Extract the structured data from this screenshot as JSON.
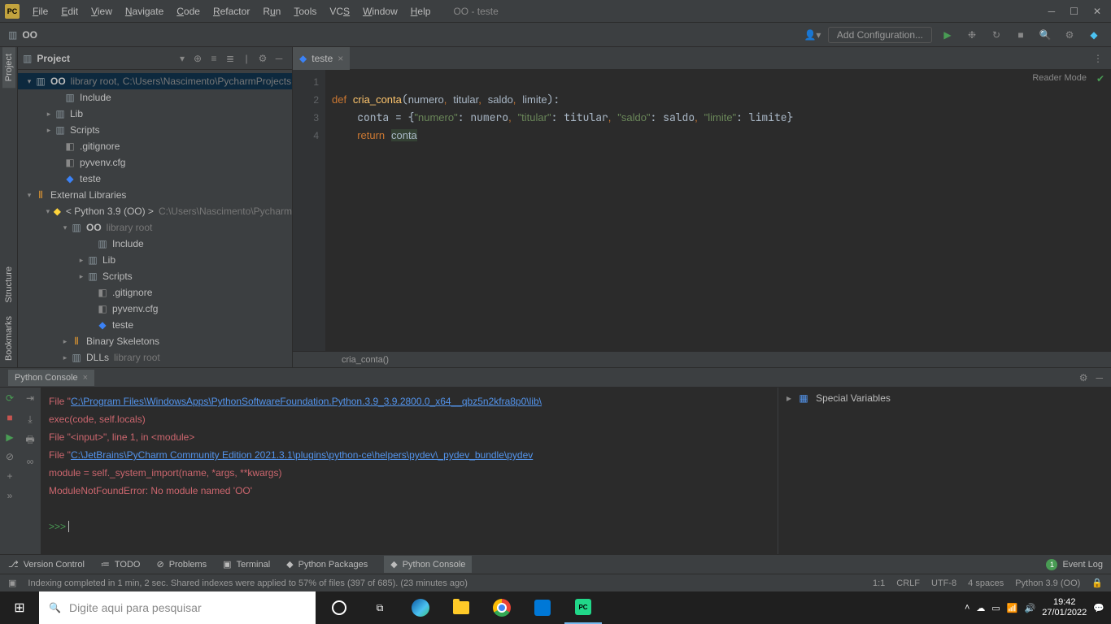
{
  "title": "OO - teste",
  "menu": [
    "File",
    "Edit",
    "View",
    "Navigate",
    "Code",
    "Refactor",
    "Run",
    "Tools",
    "VCS",
    "Window",
    "Help"
  ],
  "toolbar": {
    "crumb": "OO",
    "add_config": "Add Configuration..."
  },
  "sidebar": {
    "title": "Project",
    "root": {
      "name": "OO",
      "hint": "library root,",
      "path": "C:\\Users\\Nascimento\\PycharmProjects"
    },
    "root_children": [
      "Include",
      "Lib",
      "Scripts",
      ".gitignore",
      "pyvenv.cfg",
      "teste"
    ],
    "ext_lib": "External Libraries",
    "py_env": "< Python 3.9 (OO) >",
    "py_env_path": "C:\\Users\\Nascimento\\Pycharm",
    "oo": "OO",
    "oo_hint": "library root",
    "oo_children": [
      "Include",
      "Lib",
      "Scripts",
      ".gitignore",
      "pyvenv.cfg",
      "teste"
    ],
    "bin_skel": "Binary Skeletons",
    "dlls": "DLLs",
    "dlls_hint": "library root"
  },
  "editor": {
    "tab": "teste",
    "lines": [
      "1",
      "2",
      "3",
      "4"
    ],
    "breadcrumb": "cria_conta()",
    "reader_mode": "Reader Mode"
  },
  "console": {
    "title": "Python Console",
    "file1_pre": "  File \"",
    "file1_link": "C:\\Program Files\\WindowsApps\\PythonSoftwareFoundation.Python.3.9_3.9.2800.0_x64__qbz5n2kfra8p0\\lib\\",
    "line2": "    exec(code, self.locals)",
    "line3": "  File \"<input>\", line 1, in <module>",
    "file4_pre": "  File \"",
    "file4_link": "C:\\JetBrains\\PyCharm Community Edition 2021.3.1\\plugins\\python-ce\\helpers\\pydev\\_pydev_bundle\\pydev",
    "line5": "    module = self._system_import(name, *args, **kwargs)",
    "line6": "ModuleNotFoundError: No module named 'OO'",
    "prompt": ">>> ",
    "vars_label": "Special Variables"
  },
  "bottom_tabs": {
    "vcs": "Version Control",
    "todo": "TODO",
    "problems": "Problems",
    "terminal": "Terminal",
    "packages": "Python Packages",
    "console": "Python Console",
    "event_log": "Event Log",
    "badge": "1"
  },
  "status": {
    "msg": "Indexing completed in 1 min, 2 sec. Shared indexes were applied to 57% of files (397 of 685). (23 minutes ago)",
    "line_col": "1:1",
    "sep": "CRLF",
    "enc": "UTF-8",
    "indent": "4 spaces",
    "python": "Python 3.9 (OO)"
  },
  "taskbar": {
    "search_placeholder": "Digite aqui para pesquisar",
    "time": "19:42",
    "date": "27/01/2022"
  },
  "vtabs": {
    "project": "Project",
    "structure": "Structure",
    "bookmarks": "Bookmarks"
  }
}
